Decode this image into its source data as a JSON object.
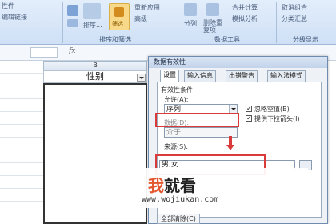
{
  "ribbon": {
    "items": [
      "性件",
      "编辑链接",
      "排序...",
      "筛选",
      "重新应用",
      "高级",
      "分列",
      "删除重复项",
      "合并计算",
      "模拟分析",
      "取消组合",
      "分类汇总"
    ],
    "groups": [
      "排序和筛选",
      "数据工具",
      "分级显示"
    ]
  },
  "formula_bar": {
    "fx": "fx"
  },
  "sheet": {
    "column_letter": "B",
    "header_text": "性别"
  },
  "dialog": {
    "title": "数据有效性",
    "tabs": [
      "设置",
      "输入信息",
      "出错警告",
      "输入法模式"
    ],
    "section_label": "有效性条件",
    "allow_label": "允许(A):",
    "allow_value": "序列",
    "data_label": "数据(D):",
    "data_value": "介于",
    "ignore_blank": "忽略空值(B)",
    "dropdown_arrow": "提供下拉箭头(I)",
    "source_label": "来源(S):",
    "source_value": "男,女",
    "clear_all": "全部清除(C)"
  },
  "watermark": {
    "logo_accent": "我",
    "logo_rest": "就看",
    "url": "www.wojiukan.com"
  },
  "colors": {
    "highlight_red": "#d93a3a",
    "ribbon_blue": "#cfe0f6",
    "active_filter": "#f8d98a"
  }
}
